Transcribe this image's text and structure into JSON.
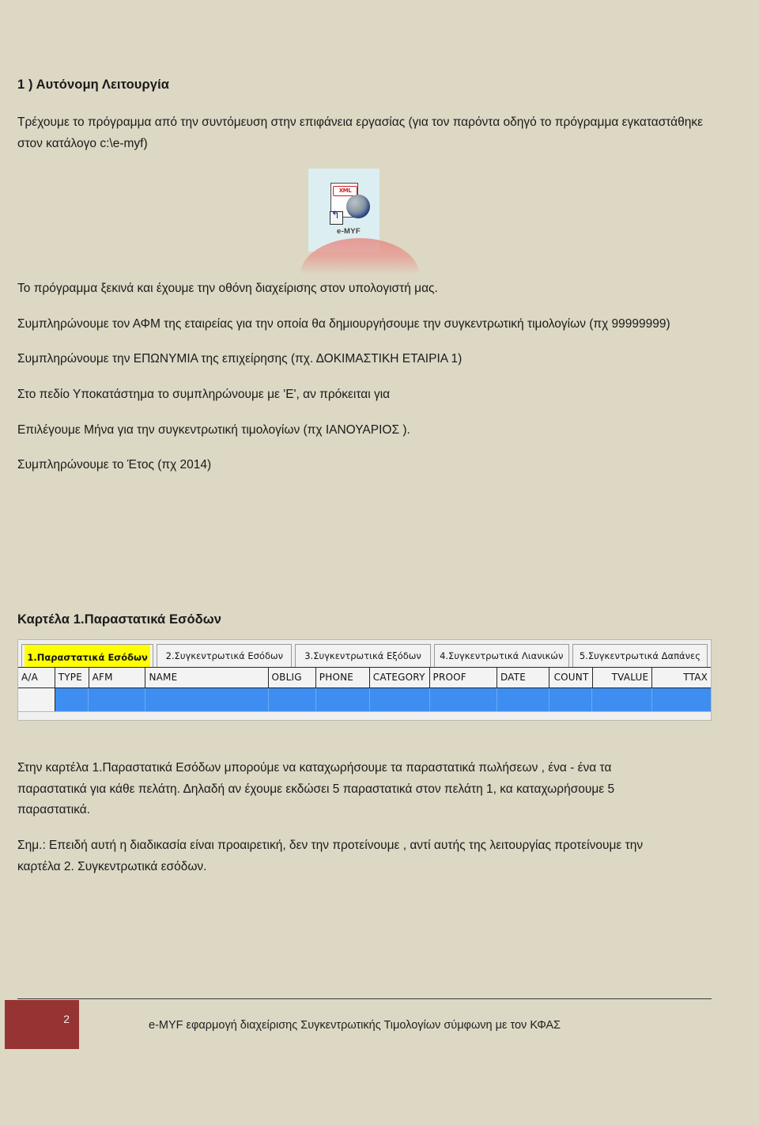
{
  "document": {
    "heading": "1 ) Αυτόνομη Λειτουργία",
    "paragraphs": [
      "Τρέχουμε το πρόγραμμα από την συντόμευση στην επιφάνεια εργασίας (για τον παρόντα οδηγό το πρόγραμμα εγκαταστάθηκε στον κατάλογο c:\\e-myf)",
      "Το πρόγραμμα ξεκινά και έχουμε την οθόνη διαχείρισης στον υπολογιστή μας.",
      "Συμπληρώνουμε τον ΑΦΜ της εταιρείας για την οποία θα δημιουργήσουμε την συγκεντρωτική τιμολογίων (πχ 99999999)",
      "Συμπληρώνουμε την  ΕΠΩΝΥΜΙΑ της επιχείρησης  (πχ. ΔΟΚΙΜΑΣΤΙΚΗ ΕΤΑΙΡΙΑ 1)",
      "Στο πεδίο Υποκατάστημα το συμπληρώνουμε με 'Ε', αν πρόκειται για",
      "Επιλέγουμε Μήνα για την συγκεντρωτική τιμολογίων (πχ ΙΑΝΟΥΑΡΙΟΣ ).",
      "Συμπληρώνουμε το Έτος (πχ 2014)"
    ],
    "section_heading": "Καρτέλα   1.Παραστατικά Εσόδων",
    "closing_paragraphs": [
      "Στην καρτέλα 1.Παραστατικά Εσόδων  μπορούμε να καταχωρήσουμε τα παραστατικά πωλήσεων , ένα - ένα  τα παραστατικά για κάθε πελάτη. Δηλαδή  αν έχουμε εκδώσει 5 παραστατικά στον πελάτη 1, κα καταχωρήσουμε 5 παραστατικά.",
      "Σημ.: Επειδή αυτή η διαδικασία είναι προαιρετική, δεν την προτείνουμε , αντί αυτής της λειτουργίας προτείνουμε την καρτέλα 2. Συγκεντρωτικά εσόδων."
    ]
  },
  "desktop_icon": {
    "label": "e-MYF",
    "doc_tag": "XML"
  },
  "app_screenshot": {
    "tabs": [
      {
        "label": "1.Παραστατικά Εσόδων",
        "selected": true
      },
      {
        "label": "2.Συγκεντρωτικά Εσόδων",
        "selected": false
      },
      {
        "label": "3.Συγκεντρωτικά Εξόδων",
        "selected": false
      },
      {
        "label": "4.Συγκεντρωτικά Λιανικών",
        "selected": false
      },
      {
        "label": "5.Συγκεντρωτικά Δαπάνες",
        "selected": false
      }
    ],
    "grid_columns": [
      "A/A",
      "TYPE",
      "AFM",
      "NAME",
      "OBLIG",
      "PHONE",
      "CATEGORY",
      "PROOF",
      "DATE",
      "COUNT",
      "TVALUE",
      "TTAX"
    ],
    "grid_rows": [
      [
        "",
        "",
        "",
        "",
        "",
        "",
        "",
        "",
        "",
        "",
        "",
        ""
      ]
    ],
    "selection_color": "#3d8ef0",
    "highlight_color": "#ffff00"
  },
  "footer": {
    "page_number": "2",
    "text": "e-MYF εφαρμογή διαχείρισης Συγκεντρωτικής Τιμολογίων σύμφωνη με τον ΚΦΑΣ",
    "badge_color": "#963434"
  }
}
